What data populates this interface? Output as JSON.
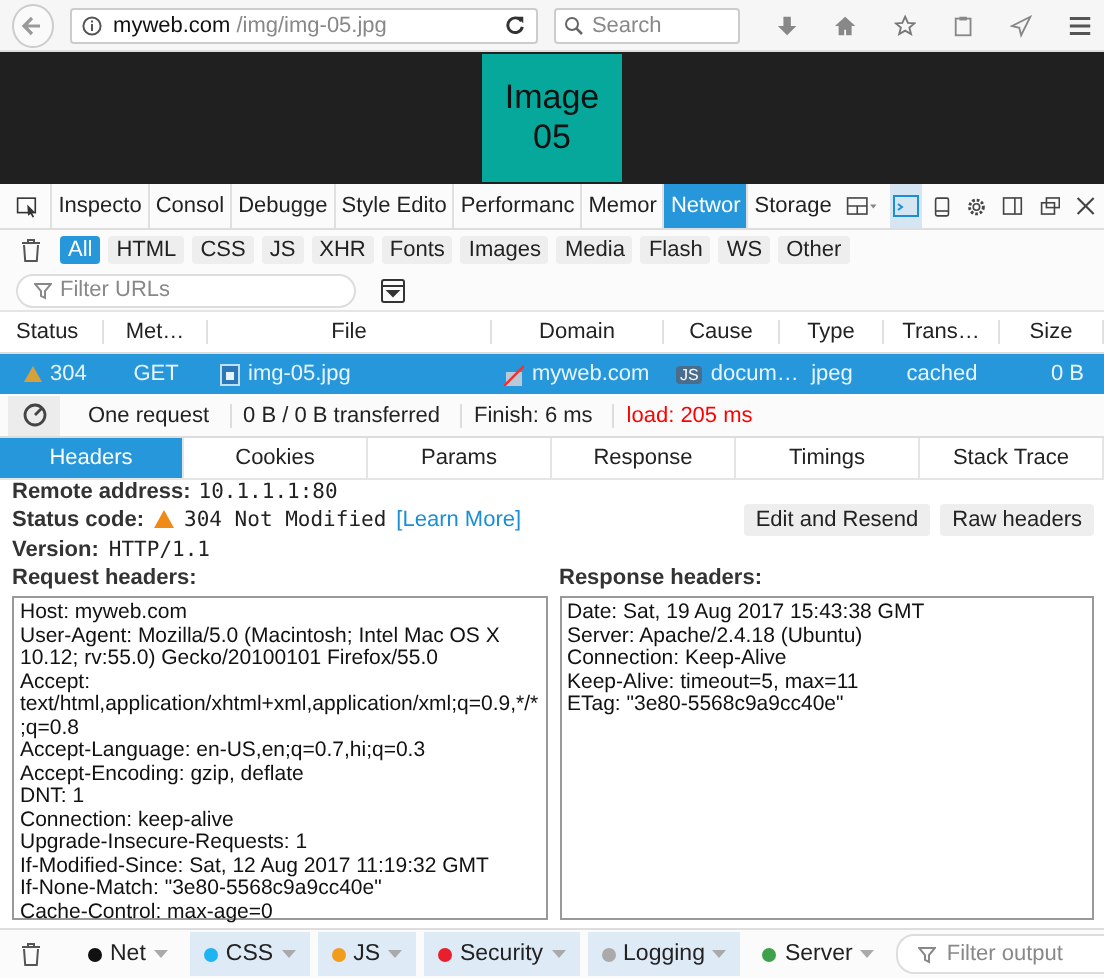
{
  "browser": {
    "url_host": "myweb.com",
    "url_path": "/img/img-05.jpg",
    "search_placeholder": "Search"
  },
  "page": {
    "image_text": [
      "Image",
      "05"
    ]
  },
  "devtools_tabs": [
    {
      "label": "Inspecto",
      "selected": false
    },
    {
      "label": "Consol",
      "selected": false
    },
    {
      "label": "Debugge",
      "selected": false
    },
    {
      "label": "Style Edito",
      "selected": false
    },
    {
      "label": "Performanc",
      "selected": false
    },
    {
      "label": "Memor",
      "selected": false
    },
    {
      "label": "Networ",
      "selected": true
    },
    {
      "label": "Storage",
      "selected": false
    }
  ],
  "type_filters": [
    {
      "label": "All",
      "selected": true
    },
    {
      "label": "HTML",
      "selected": false
    },
    {
      "label": "CSS",
      "selected": false
    },
    {
      "label": "JS",
      "selected": false
    },
    {
      "label": "XHR",
      "selected": false
    },
    {
      "label": "Fonts",
      "selected": false
    },
    {
      "label": "Images",
      "selected": false
    },
    {
      "label": "Media",
      "selected": false
    },
    {
      "label": "Flash",
      "selected": false
    },
    {
      "label": "WS",
      "selected": false
    },
    {
      "label": "Other",
      "selected": false
    }
  ],
  "filter_urls": {
    "placeholder": "Filter URLs"
  },
  "table": {
    "columns": [
      "Status",
      "Met…",
      "File",
      "Domain",
      "Cause",
      "Type",
      "Trans…",
      "Size"
    ],
    "rows": [
      {
        "selected": true,
        "status": "304",
        "method": "GET",
        "file": "img-05.jpg",
        "domain": "myweb.com",
        "cause_badge": "JS",
        "cause": "docum…",
        "type": "jpeg",
        "transferred": "cached",
        "size": "0 B"
      }
    ]
  },
  "summary": {
    "requests": "One request",
    "transferred": "0 B / 0 B transferred",
    "finish": "Finish: 6 ms",
    "load": "load: 205 ms"
  },
  "detail_tabs": [
    {
      "label": "Headers",
      "selected": true
    },
    {
      "label": "Cookies",
      "selected": false
    },
    {
      "label": "Params",
      "selected": false
    },
    {
      "label": "Response",
      "selected": false
    },
    {
      "label": "Timings",
      "selected": false
    },
    {
      "label": "Stack Trace",
      "selected": false
    }
  ],
  "headers": {
    "remote_label": "Remote address:",
    "remote_value": "10.1.1.1:80",
    "status_label": "Status code:",
    "status_value": "304 Not Modified",
    "learn_more": "[Learn More]",
    "edit_button": "Edit and Resend",
    "raw_button": "Raw headers",
    "version_label": "Version:",
    "version_value": "HTTP/1.1",
    "request_title": "Request headers:",
    "request_lines": [
      "Host: myweb.com",
      "User-Agent: Mozilla/5.0 (Macintosh; Intel Mac OS X 10.12; rv:55.0) Gecko/20100101 Firefox/55.0",
      "Accept: text/html,application/xhtml+xml,application/xml;q=0.9,*/*;q=0.8",
      "Accept-Language: en-US,en;q=0.7,hi;q=0.3",
      "Accept-Encoding: gzip, deflate",
      "DNT: 1",
      "Connection: keep-alive",
      "Upgrade-Insecure-Requests: 1",
      "If-Modified-Since: Sat, 12 Aug 2017 11:19:32 GMT",
      "If-None-Match: \"3e80-5568c9a9cc40e\"",
      "Cache-Control: max-age=0"
    ],
    "response_title": "Response headers:",
    "response_lines": [
      "Date: Sat, 19 Aug 2017 15:43:38 GMT",
      "Server: Apache/2.4.18 (Ubuntu)",
      "Connection: Keep-Alive",
      "Keep-Alive: timeout=5, max=11",
      "ETag: \"3e80-5568c9a9cc40e\""
    ]
  },
  "console_filters": [
    {
      "label": "Net",
      "color": "#111111",
      "on": false
    },
    {
      "label": "CSS",
      "color": "#1eb4ef",
      "on": true
    },
    {
      "label": "JS",
      "color": "#f29c1e",
      "on": true
    },
    {
      "label": "Security",
      "color": "#e8202e",
      "on": true
    },
    {
      "label": "Logging",
      "color": "#aaaaaa",
      "on": true
    },
    {
      "label": "Server",
      "color": "#3fa14a",
      "on": false
    }
  ],
  "console_filter": {
    "placeholder": "Filter output"
  }
}
